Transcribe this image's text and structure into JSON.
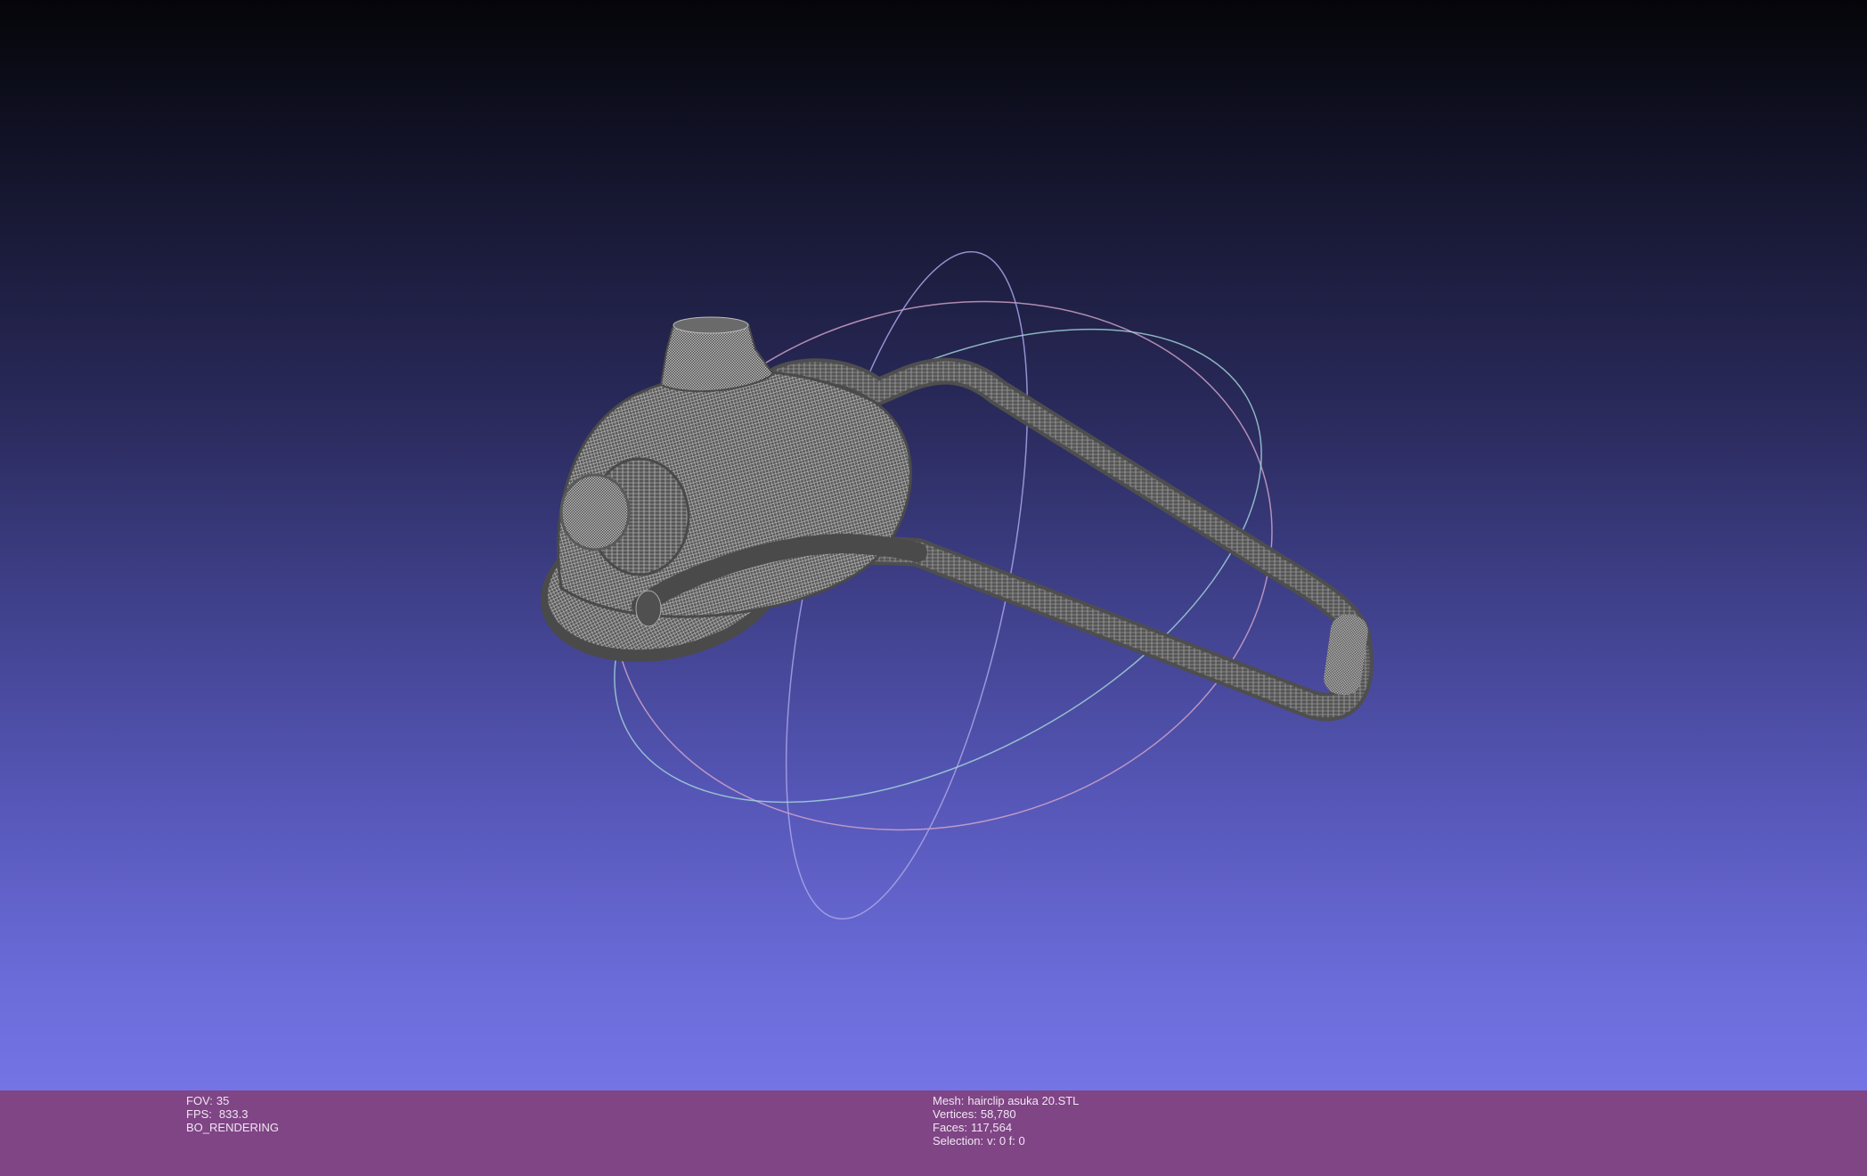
{
  "left_info": {
    "fov_label": "FOV:",
    "fov_value": "35",
    "fps_label": "FPS:",
    "fps_value": "833.3",
    "render_mode": "BO_RENDERING"
  },
  "right_info": {
    "mesh_label": "Mesh:",
    "mesh_name": "hairclip asuka 20.STL",
    "vertices_label": "Vertices:",
    "vertices_value": "58,780",
    "faces_label": "Faces:",
    "faces_value": "117,564",
    "selection_label": "Selection:",
    "selection_value": "v: 0 f: 0"
  },
  "viewport": {
    "mesh_color": "#5a5a5a",
    "wire_color": "#bdbdbd",
    "trackball_colors": [
      "#d8a0c8",
      "#9aa0e8",
      "#a8e0d8"
    ]
  }
}
